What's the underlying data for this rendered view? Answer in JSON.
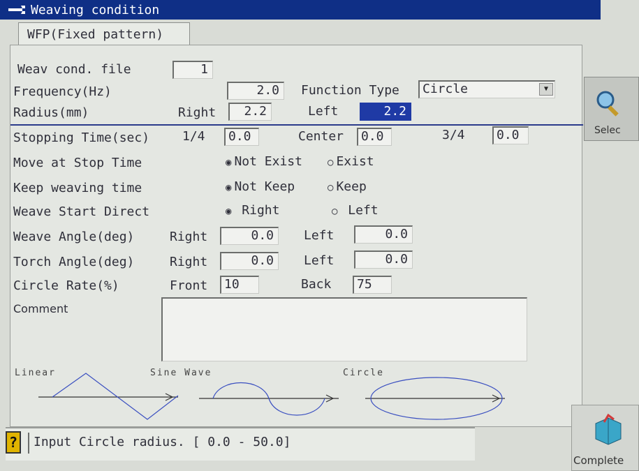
{
  "window": {
    "title": "Weaving condition"
  },
  "tab": {
    "label": "WFP(Fixed pattern)"
  },
  "form": {
    "file_label": "Weav cond. file",
    "file_value": "1",
    "frequency_label": "Frequency(Hz)",
    "frequency_value": "2.0",
    "function_type_label": "Function Type",
    "function_type_value": "Circle",
    "radius_label": "Radius(mm)",
    "right_label": "Right",
    "left_label": "Left",
    "radius_right": "2.2",
    "radius_left": "2.2",
    "stopping_label": "Stopping Time(sec)",
    "quarter_label": "1/4",
    "stopping_quarter": "0.0",
    "center_label": "Center",
    "stopping_center": "0.0",
    "three_quarter_label": "3/4",
    "stopping_three_quarter": "0.0",
    "move_label": "Move at Stop Time",
    "move_opt1": "Not Exist",
    "move_opt2": "Exist",
    "keep_label": "Keep weaving time",
    "keep_opt1": "Not Keep",
    "keep_opt2": "Keep",
    "start_label": "Weave Start Direct",
    "start_opt1": "Right",
    "start_opt2": "Left",
    "weave_angle_label": "Weave Angle(deg)",
    "weave_angle_right": "0.0",
    "weave_angle_left": "0.0",
    "torch_angle_label": "Torch Angle(deg)",
    "torch_angle_right": "0.0",
    "torch_angle_left": "0.0",
    "circle_rate_label": "Circle Rate(%)",
    "front_label": "Front",
    "circle_front": "10",
    "back_label": "Back",
    "circle_back": "75",
    "comment_label": "Comment",
    "comment_value": ""
  },
  "patterns": {
    "linear": "Linear",
    "sine": "Sine Wave",
    "circle": "Circle"
  },
  "status": {
    "message": "Input Circle radius.  [  0.0 -  50.0]"
  },
  "side": {
    "select_label": "Selec",
    "complete_label": "Complete"
  }
}
